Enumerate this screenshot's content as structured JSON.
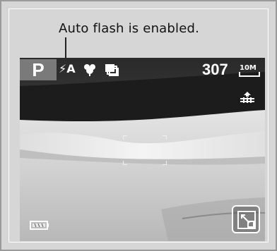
{
  "annotation": {
    "text": "Auto flash is enabled."
  },
  "hud": {
    "mode": "P",
    "flash": "⚡A",
    "shots_remaining": "307",
    "resolution": "10M",
    "icons": {
      "flash": "flash-auto-icon",
      "macro": "macro-flower-icon",
      "drive": "continuous-shooting-icon",
      "quality": "quality-icon",
      "battery": "battery-full-icon",
      "focus": "focus-frame-icon",
      "playback": "playback-resize-icon"
    }
  },
  "colors": {
    "frame_bg": "#d6d6d6",
    "mode_bg": "#7a7a7a",
    "hud_text": "#ffffff"
  }
}
